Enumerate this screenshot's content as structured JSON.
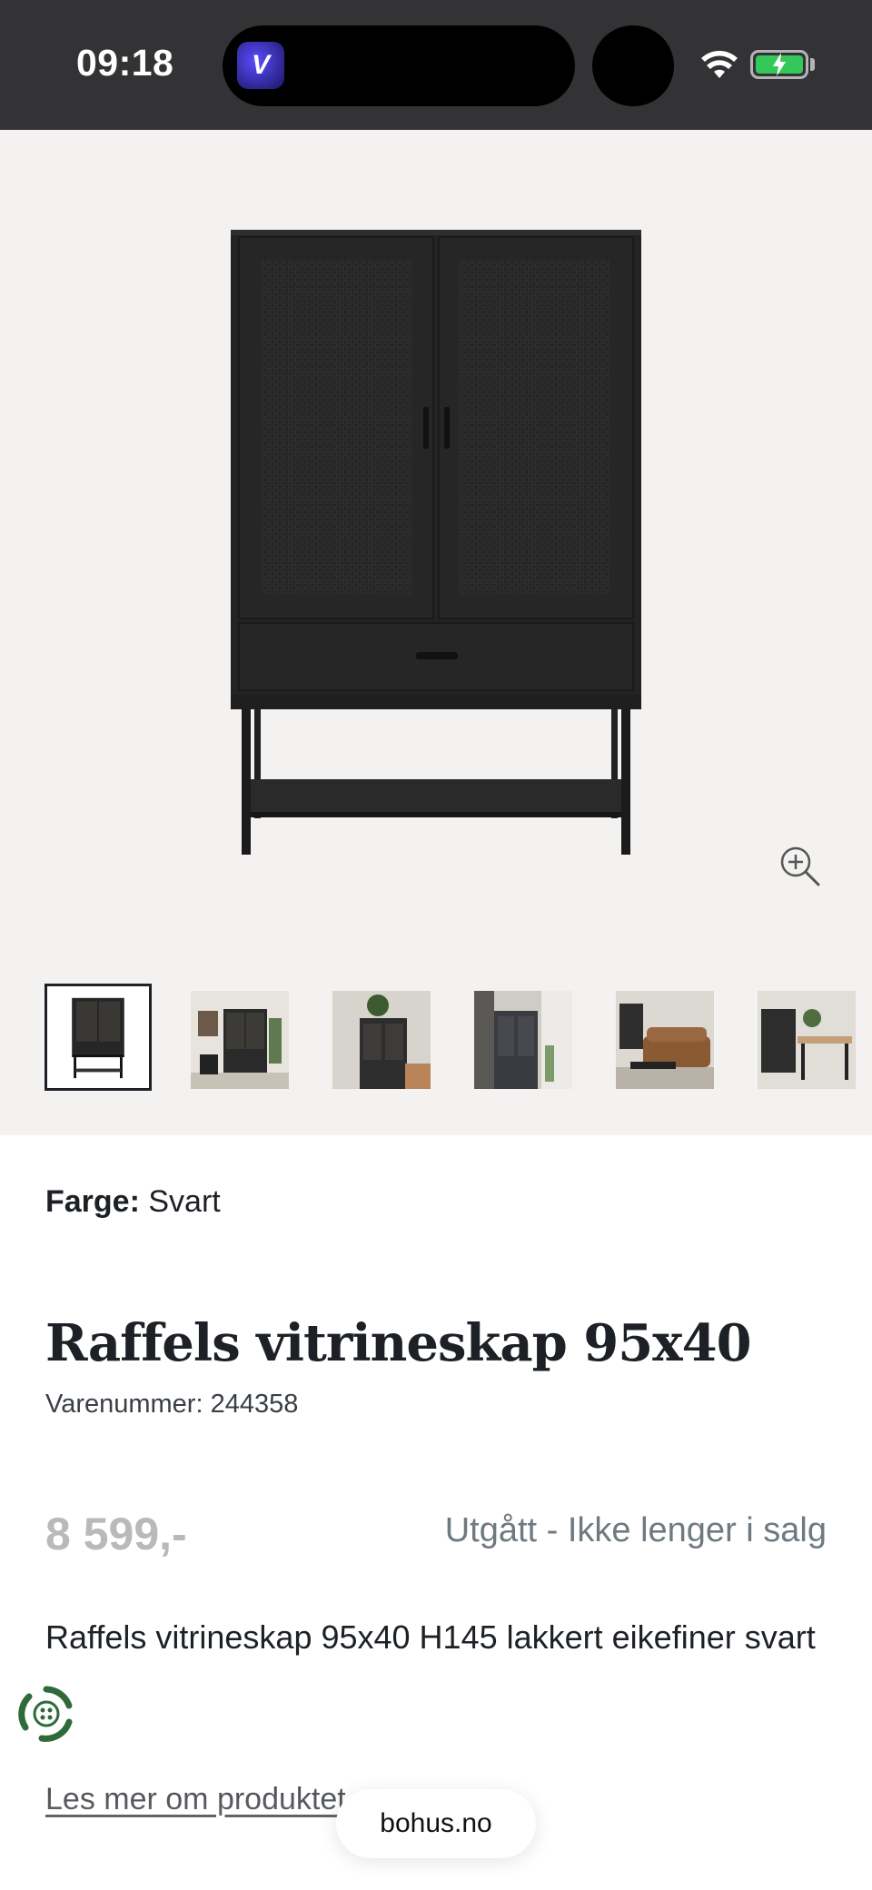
{
  "status_bar": {
    "time": "09:18",
    "island_app_icon": "browser-app-icon",
    "wifi_icon": "wifi-icon",
    "battery_icon": "battery-charging-icon",
    "battery_color": "#34c759"
  },
  "gallery": {
    "main_image_icon": "cabinet-product-image",
    "zoom_icon": "zoom-in-icon",
    "background_color": "#f3f2f0",
    "thumbnails": [
      {
        "icon": "thumbnail-product-front",
        "active": true
      },
      {
        "icon": "thumbnail-room-1",
        "active": false
      },
      {
        "icon": "thumbnail-room-2",
        "active": false
      },
      {
        "icon": "thumbnail-room-3",
        "active": false
      },
      {
        "icon": "thumbnail-room-4",
        "active": false
      },
      {
        "icon": "thumbnail-room-5",
        "active": false
      }
    ]
  },
  "product": {
    "color_label": "Farge:",
    "color_value": "Svart",
    "title": "Raffels vitrineskap 95x40",
    "sku": "Varenummer: 244358",
    "price": "8 599,-",
    "availability": "Utgått - Ikke lenger i salg",
    "description": "Raffels vitrineskap 95x40 H145 lakkert eikefiner svart",
    "read_more": "Les mer om produktet"
  },
  "floating": {
    "recycle_icon": "recycle-icon",
    "url": "bohus.no"
  }
}
